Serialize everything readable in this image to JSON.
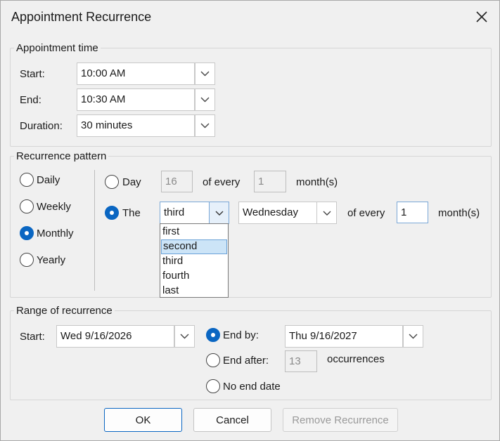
{
  "dialog": {
    "title": "Appointment Recurrence"
  },
  "appointment_time": {
    "legend": "Appointment time",
    "start": {
      "label": "Start:",
      "value": "10:00 AM"
    },
    "end": {
      "label": "End:",
      "value": "10:30 AM"
    },
    "duration": {
      "label": "Duration:",
      "value": "30 minutes"
    }
  },
  "pattern": {
    "legend": "Recurrence pattern",
    "types": [
      {
        "label": "Daily",
        "selected": false
      },
      {
        "label": "Weekly",
        "selected": false
      },
      {
        "label": "Monthly",
        "selected": true
      },
      {
        "label": "Yearly",
        "selected": false
      }
    ],
    "day_option": {
      "label": "Day",
      "day_value": "16",
      "of_every": "of every",
      "months_value": "1",
      "months_suffix": "month(s)"
    },
    "the_option": {
      "label": "The",
      "ordinal_value": "third",
      "weekday_value": "Wednesday",
      "of_every": "of every",
      "months_value": "1",
      "months_suffix": "month(s)",
      "ordinal_options": [
        "first",
        "second",
        "third",
        "fourth",
        "last"
      ],
      "highlighted_option": "second"
    }
  },
  "range": {
    "legend": "Range of recurrence",
    "start": {
      "label": "Start:",
      "value": "Wed 9/16/2026"
    },
    "end_by": {
      "label": "End by:",
      "value": "Thu 9/16/2027",
      "selected": true
    },
    "end_after": {
      "label": "End after:",
      "value": "13",
      "suffix": "occurrences"
    },
    "no_end": {
      "label": "No end date"
    }
  },
  "buttons": {
    "ok": "OK",
    "cancel": "Cancel",
    "remove": "Remove Recurrence"
  },
  "colors": {
    "accent": "#0a66c2",
    "highlight": "#cce4f7"
  }
}
